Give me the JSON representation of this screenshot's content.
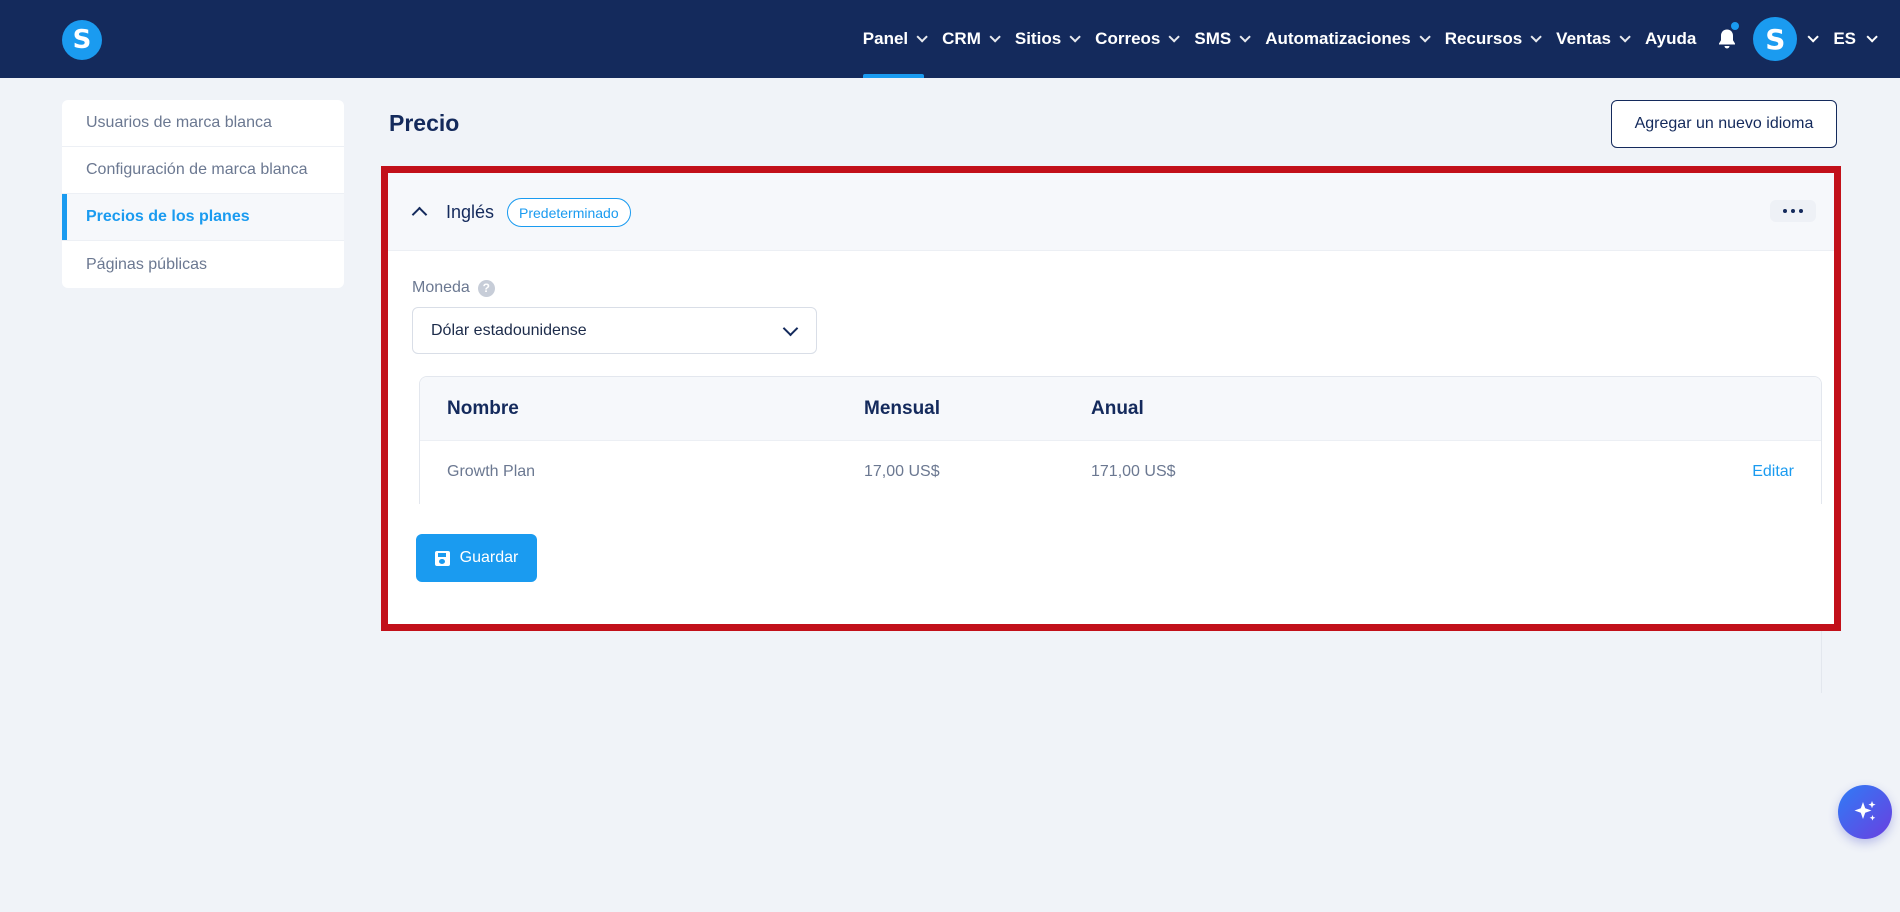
{
  "brand": {
    "logo_letter": "S"
  },
  "nav": {
    "items": [
      {
        "label": "Panel",
        "active": true
      },
      {
        "label": "CRM"
      },
      {
        "label": "Sitios"
      },
      {
        "label": "Correos"
      },
      {
        "label": "SMS"
      },
      {
        "label": "Automatizaciones"
      },
      {
        "label": "Recursos"
      },
      {
        "label": "Ventas"
      },
      {
        "label": "Ayuda"
      }
    ],
    "avatar_letter": "S",
    "language": "ES"
  },
  "sidebar": {
    "items": [
      {
        "label": "Usuarios de marca blanca"
      },
      {
        "label": "Configuración de marca blanca"
      },
      {
        "label": "Precios de los planes",
        "active": true
      },
      {
        "label": "Páginas públicas"
      }
    ]
  },
  "page": {
    "title": "Precio",
    "add_language_label": "Agregar un nuevo idioma"
  },
  "language_card": {
    "name": "Inglés",
    "badge": "Predeterminado",
    "currency_label": "Moneda",
    "help_glyph": "?",
    "currency_value": "Dólar estadounidense",
    "table": {
      "headers": [
        "Nombre",
        "Mensual",
        "Anual"
      ],
      "rows": [
        {
          "name": "Growth Plan",
          "monthly": "17,00 US$",
          "annual": "171,00 US$",
          "action": "Editar"
        }
      ]
    },
    "save_label": "Guardar"
  },
  "colors": {
    "nav_bg": "#142a5c",
    "accent": "#1a9bf0",
    "highlight_border": "#c2101a"
  },
  "icons": [
    "bell-icon",
    "chevron-down-icon",
    "chevron-up-icon",
    "more-horizontal-icon",
    "help-icon",
    "save-disk-icon",
    "sparkle-icon"
  ]
}
